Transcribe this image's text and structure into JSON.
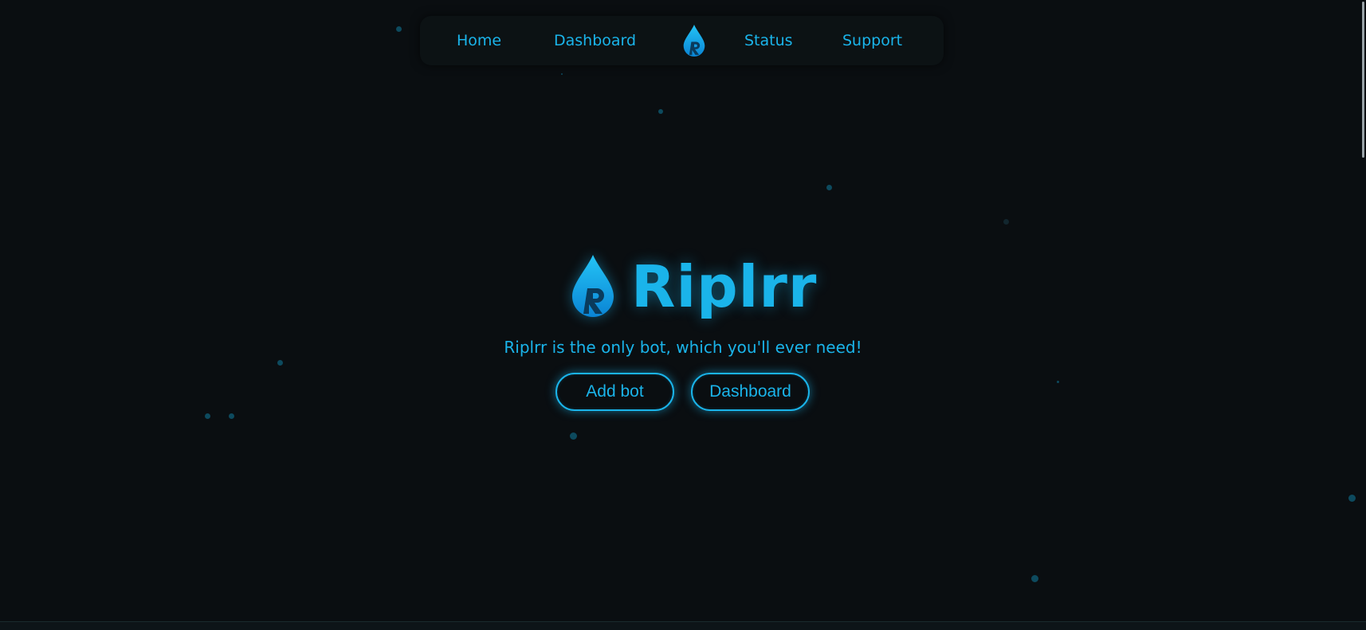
{
  "nav": {
    "links": [
      {
        "label": "Home"
      },
      {
        "label": "Dashboard"
      },
      {
        "label": "Status"
      },
      {
        "label": "Support"
      }
    ],
    "logo_icon": "water-drop-r-icon"
  },
  "hero": {
    "title": "Riplrr",
    "tagline": "Riplrr is the only bot, which you'll ever need!",
    "buttons": [
      {
        "label": "Add bot"
      },
      {
        "label": "Dashboard"
      }
    ],
    "logo_icon": "water-drop-r-icon"
  },
  "colors": {
    "background": "#0a0e11",
    "accent": "#1ab4ea",
    "nav_background": "#0c1214",
    "particle": "#0d4a5e"
  }
}
